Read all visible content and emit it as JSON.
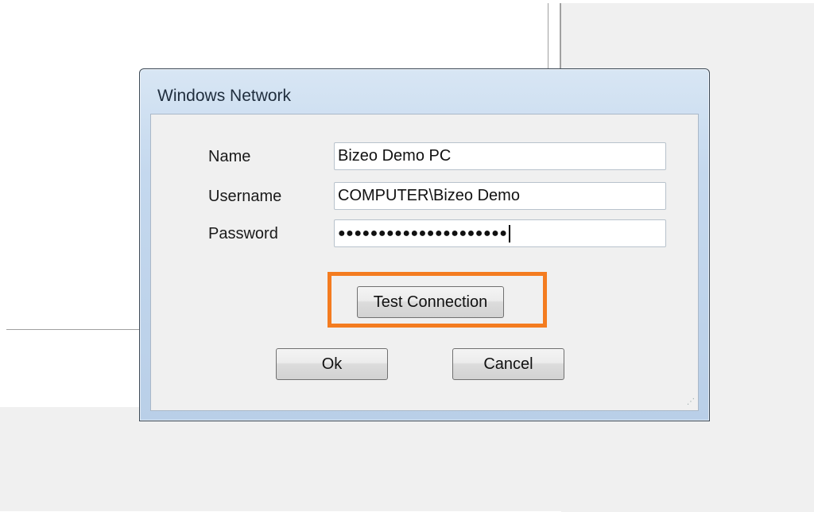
{
  "dialog": {
    "title": "Windows Network",
    "fields": {
      "name": {
        "label": "Name",
        "value": "Bizeo Demo PC"
      },
      "username": {
        "label": "Username",
        "value": "COMPUTER\\Bizeo Demo"
      },
      "password": {
        "label": "Password",
        "masked_value": "●●●●●●●●●●●●●●●●●●●●●"
      }
    },
    "buttons": {
      "test_connection": "Test Connection",
      "ok": "Ok",
      "cancel": "Cancel"
    }
  },
  "colors": {
    "highlight": "#f47c20",
    "title_bar": "#c4d8ee",
    "client_bg": "#f0f0f0"
  }
}
